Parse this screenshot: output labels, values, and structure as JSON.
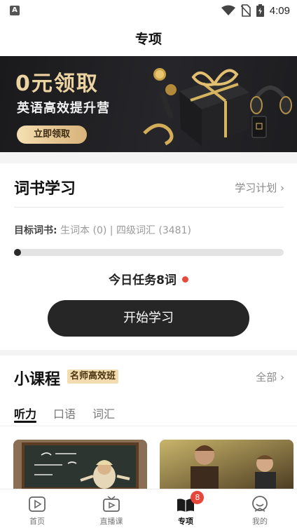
{
  "status_bar": {
    "time": "4:09",
    "left_icon": "A"
  },
  "header": {
    "title": "专项"
  },
  "banner": {
    "headline": "0元领取",
    "subtitle": "英语高效提升营",
    "cta_label": "立即领取"
  },
  "vocab": {
    "title": "词书学习",
    "plan_link": "学习计划",
    "target_label": "目标词书:",
    "target_value": "生词本 (0) | 四级词汇 (3481)",
    "progress_fraction": 0.02,
    "task_text": "今日任务8词",
    "start_button": "开始学习"
  },
  "courses": {
    "title": "小课程",
    "badge": "名师高效班",
    "all_link": "全部",
    "tabs": [
      {
        "label": "听力",
        "active": true
      },
      {
        "label": "口语",
        "active": false
      },
      {
        "label": "词汇",
        "active": false
      }
    ]
  },
  "bottom_nav": {
    "items": [
      {
        "label": "首页",
        "icon": "home-play-icon",
        "active": false
      },
      {
        "label": "直播课",
        "icon": "tv-icon",
        "active": false
      },
      {
        "label": "专项",
        "icon": "book-icon",
        "active": true,
        "badge": "8"
      },
      {
        "label": "我的",
        "icon": "profile-icon",
        "active": false
      }
    ]
  },
  "colors": {
    "accent_gold": "#ecd3a2",
    "badge_red": "#e5483b",
    "button_dark": "#262626"
  }
}
